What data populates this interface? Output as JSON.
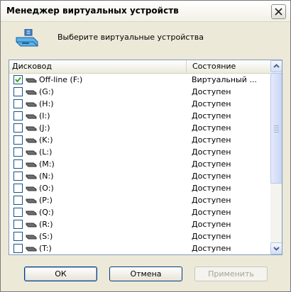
{
  "window": {
    "title": "Менеджер виртуальных устройств"
  },
  "header": {
    "prompt": "Выберите виртуальные устройства"
  },
  "list": {
    "columns": {
      "drive": "Дисковод",
      "state": "Состояние"
    },
    "rows": [
      {
        "drive": "Off-line (F:)",
        "state": "Виртуальный ...",
        "checked": true
      },
      {
        "drive": "(G:)",
        "state": "Доступен",
        "checked": false
      },
      {
        "drive": "(H:)",
        "state": "Доступен",
        "checked": false
      },
      {
        "drive": "(I:)",
        "state": "Доступен",
        "checked": false
      },
      {
        "drive": "(J:)",
        "state": "Доступен",
        "checked": false
      },
      {
        "drive": "(K:)",
        "state": "Доступен",
        "checked": false
      },
      {
        "drive": "(L:)",
        "state": "Доступен",
        "checked": false
      },
      {
        "drive": "(M:)",
        "state": "Доступен",
        "checked": false
      },
      {
        "drive": "(N:)",
        "state": "Доступен",
        "checked": false
      },
      {
        "drive": "(O:)",
        "state": "Доступен",
        "checked": false
      },
      {
        "drive": "(P:)",
        "state": "Доступен",
        "checked": false
      },
      {
        "drive": "(Q:)",
        "state": "Доступен",
        "checked": false
      },
      {
        "drive": "(R:)",
        "state": "Доступен",
        "checked": false
      },
      {
        "drive": "(S:)",
        "state": "Доступен",
        "checked": false
      },
      {
        "drive": "(T:)",
        "state": "Доступен",
        "checked": false
      }
    ]
  },
  "buttons": {
    "ok": "ОК",
    "cancel": "Отмена",
    "apply": "Применить"
  }
}
